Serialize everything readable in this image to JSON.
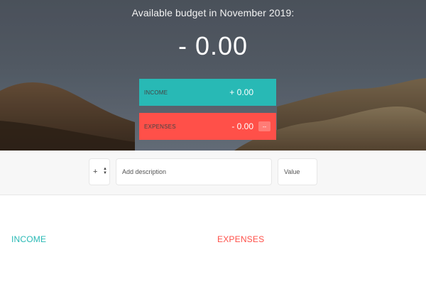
{
  "header": {
    "title": "Available budget in November 2019:",
    "budget": "- 0.00"
  },
  "summary": {
    "income": {
      "label": "INCOME",
      "value": "+ 0.00"
    },
    "expenses": {
      "label": "EXPENSES",
      "value": "- 0.00",
      "percentage": "--"
    }
  },
  "add": {
    "type_selected": "+",
    "description_placeholder": "Add description",
    "value_placeholder": "Value"
  },
  "lists": {
    "income_title": "INCOME",
    "expenses_title": "EXPENSES"
  },
  "colors": {
    "income": "#28b9b5",
    "expenses": "#ff5049"
  },
  "icons": {
    "type_select": "up-down-arrows-icon",
    "background": "mountains-photo"
  }
}
